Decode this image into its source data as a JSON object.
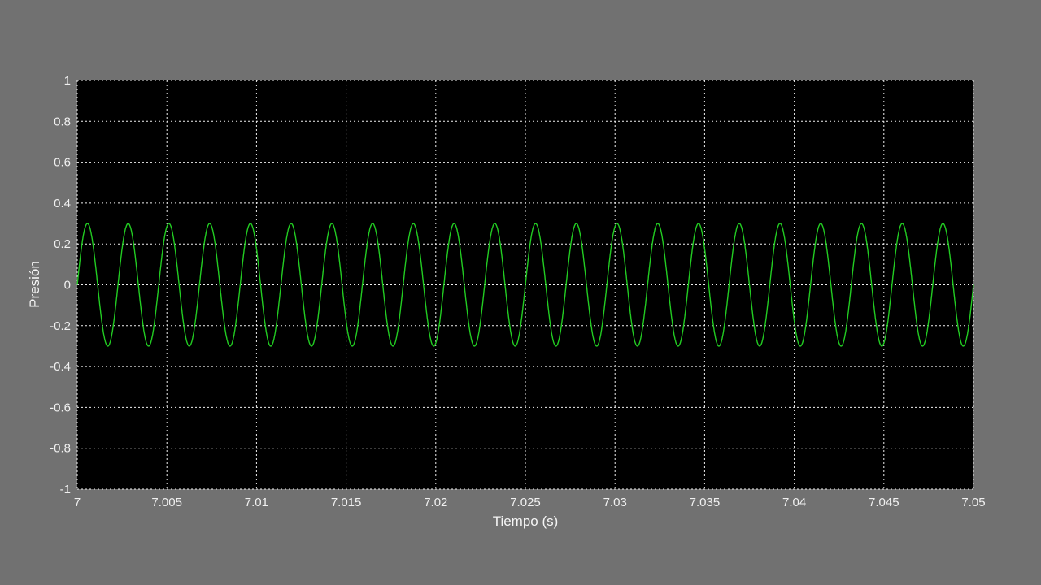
{
  "window": {
    "background_color": "#717171"
  },
  "chart_data": {
    "type": "line",
    "title": "",
    "xlabel": "Tiempo (s)",
    "ylabel": "Presión",
    "xlim": [
      7,
      7.05
    ],
    "ylim": [
      -1,
      1
    ],
    "xticks": [
      7,
      7.005,
      7.01,
      7.015,
      7.02,
      7.025,
      7.03,
      7.035,
      7.04,
      7.045,
      7.05
    ],
    "xtick_labels": [
      "7",
      "7.005",
      "7.01",
      "7.015",
      "7.02",
      "7.025",
      "7.03",
      "7.035",
      "7.04",
      "7.045",
      "7.05"
    ],
    "yticks": [
      1,
      0.8,
      0.6,
      0.4,
      0.2,
      0,
      -0.2,
      -0.4,
      -0.6,
      -0.8,
      -1
    ],
    "ytick_labels": [
      "1",
      "0.8",
      "0.6",
      "0.4",
      "0.2",
      "0",
      "-0.2",
      "-0.4",
      "-0.6",
      "-0.8",
      "-1"
    ],
    "grid": true,
    "grid_style": "dotted",
    "legend": false,
    "plot_background": "#000000",
    "grid_color": "#efefef",
    "tick_text_color": "#f0f0f0",
    "axis_label_color": "#f5f5f5",
    "series": [
      {
        "name": "Presión",
        "color": "#22cc22",
        "waveform": "sine",
        "amplitude": 0.3,
        "frequency_hz": 440,
        "phase_rad": 0
      }
    ]
  }
}
